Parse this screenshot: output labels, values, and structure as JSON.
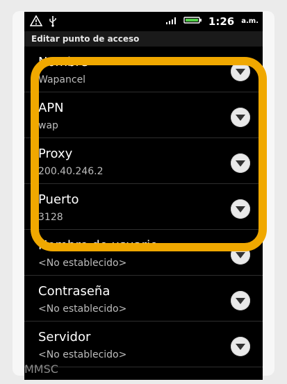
{
  "status_bar": {
    "time": "1:26",
    "ampm": "a.m."
  },
  "title": "Editar punto de acceso",
  "items": [
    {
      "label": "Nombre",
      "value": "Wapancel"
    },
    {
      "label": "APN",
      "value": "wap"
    },
    {
      "label": "Proxy",
      "value": "200.40.246.2"
    },
    {
      "label": "Puerto",
      "value": "3128"
    },
    {
      "label": "Nombre de usuario",
      "value": "<No establecido>"
    },
    {
      "label": "Contraseña",
      "value": "<No establecido>"
    },
    {
      "label": "Servidor",
      "value": "<No establecido>"
    }
  ],
  "cutoff_label": "MMSC",
  "colors": {
    "highlight": "#f0a800",
    "background": "#000000"
  },
  "icons": {
    "warning": "warning-icon",
    "usb": "usb-icon",
    "signal": "signal-icon",
    "battery": "battery-icon",
    "dropdown": "chevron-down-icon"
  }
}
